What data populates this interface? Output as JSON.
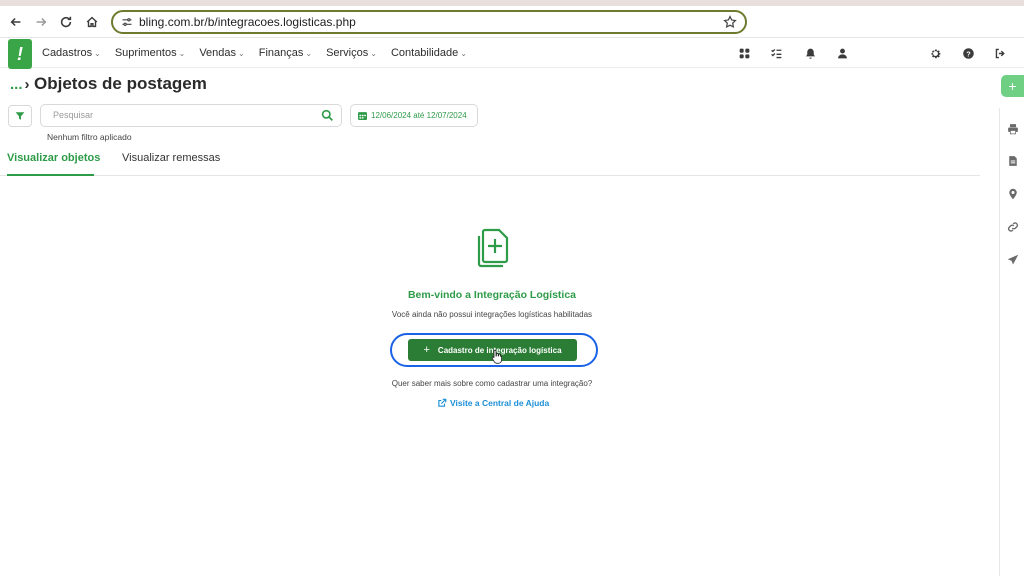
{
  "browser": {
    "url": "bling.com.br/b/integracoes.logisticas.php",
    "icons": [
      "back-arrow-icon",
      "forward-arrow-icon",
      "reload-icon",
      "home-icon",
      "site-settings-icon",
      "bookmark-star-icon"
    ]
  },
  "header": {
    "logo": "!",
    "menu": [
      {
        "label": "Cadastros"
      },
      {
        "label": "Suprimentos"
      },
      {
        "label": "Vendas"
      },
      {
        "label": "Finanças"
      },
      {
        "label": "Serviços"
      },
      {
        "label": "Contabilidade"
      }
    ],
    "right_icons": [
      "apps-grid-icon",
      "tasks-checklist-icon",
      "bell-icon",
      "user-icon",
      "gear-icon",
      "help-icon",
      "logout-icon"
    ]
  },
  "page": {
    "breadcrumb": "...",
    "title": "Objetos de postagem",
    "search_placeholder": "Pesquisar",
    "date_range": "12/06/2024 até 12/07/2024",
    "filter_status": "Nenhum filtro aplicado",
    "tabs": [
      {
        "label": "Visualizar objetos",
        "active": true
      },
      {
        "label": "Visualizar remessas",
        "active": false
      }
    ]
  },
  "empty_state": {
    "icon": "document-add-icon",
    "title": "Bem-vindo a Integração Logística",
    "subtitle": "Você ainda não possui integrações logísticas habilitadas",
    "button_label": "Cadastro de integração logística",
    "help_question": "Quer saber mais sobre como cadastrar uma integração?",
    "help_link": "Visite a Central de Ajuda"
  },
  "right_rail": {
    "add": "+",
    "icons": [
      "print-icon",
      "document-icon",
      "location-pin-icon",
      "link-icon",
      "send-icon"
    ]
  },
  "colors": {
    "brand_green": "#2e9b48",
    "button_green": "#2b7d35",
    "highlight_blue": "#1a63e6",
    "link_blue": "#1d8fd6"
  }
}
